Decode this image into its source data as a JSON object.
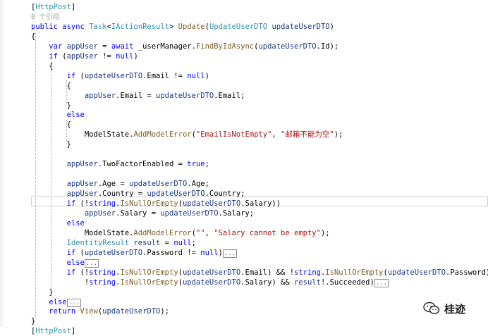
{
  "colors": {
    "keyword": "#0000ff",
    "type": "#2b91af",
    "string": "#a31515",
    "method": "#795e26",
    "variable": "#1f377f",
    "plain": "#000000",
    "codelens": "#9a9a9a",
    "attribute": "#2b91af"
  },
  "watermark": {
    "icon": "wechat-icon",
    "text": "桂迹"
  },
  "code_lines": [
    {
      "tokens": [
        [
          "plain",
          "["
        ],
        [
          "type",
          "HttpPost"
        ],
        [
          "plain",
          "]"
        ]
      ]
    },
    {
      "tokens": [
        [
          "codelens",
          "0 个引用"
        ]
      ]
    },
    {
      "tokens": [
        [
          "keyword",
          "public "
        ],
        [
          "keyword",
          "async "
        ],
        [
          "type",
          "Task"
        ],
        [
          "plain",
          "<"
        ],
        [
          "type",
          "IActionResult"
        ],
        [
          "plain",
          "> "
        ],
        [
          "method",
          "Update"
        ],
        [
          "plain",
          "("
        ],
        [
          "type",
          "UpdateUserDTO"
        ],
        [
          "plain",
          " "
        ],
        [
          "variable",
          "updateUserDTO"
        ],
        [
          "plain",
          ")"
        ]
      ]
    },
    {
      "tokens": [
        [
          "plain",
          "{"
        ]
      ]
    },
    {
      "tokens": [
        [
          "keyword",
          "    var "
        ],
        [
          "variable",
          "appUser"
        ],
        [
          "plain",
          " = "
        ],
        [
          "keyword",
          "await "
        ],
        [
          "plain",
          "_userManager."
        ],
        [
          "method",
          "FindByIdAsync"
        ],
        [
          "plain",
          "("
        ],
        [
          "variable",
          "updateUserDTO"
        ],
        [
          "plain",
          ".Id);"
        ]
      ]
    },
    {
      "tokens": [
        [
          "keyword",
          "    if "
        ],
        [
          "plain",
          "("
        ],
        [
          "variable",
          "appUser"
        ],
        [
          "plain",
          " != "
        ],
        [
          "keyword",
          "null"
        ],
        [
          "plain",
          ")"
        ]
      ]
    },
    {
      "tokens": [
        [
          "plain",
          "    {"
        ]
      ]
    },
    {
      "tokens": [
        [
          "keyword",
          "        if "
        ],
        [
          "plain",
          "("
        ],
        [
          "variable",
          "updateUserDTO"
        ],
        [
          "plain",
          ".Email != "
        ],
        [
          "keyword",
          "null"
        ],
        [
          "plain",
          ")"
        ]
      ]
    },
    {
      "tokens": [
        [
          "plain",
          "        {"
        ]
      ]
    },
    {
      "tokens": [
        [
          "plain",
          "            "
        ],
        [
          "variable",
          "appUser"
        ],
        [
          "plain",
          ".Email = "
        ],
        [
          "variable",
          "updateUserDTO"
        ],
        [
          "plain",
          ".Email;"
        ]
      ]
    },
    {
      "tokens": [
        [
          "plain",
          "        }"
        ]
      ]
    },
    {
      "tokens": [
        [
          "keyword",
          "        else"
        ]
      ]
    },
    {
      "tokens": [
        [
          "plain",
          "        {"
        ]
      ]
    },
    {
      "tokens": [
        [
          "plain",
          "            ModelState."
        ],
        [
          "method",
          "AddModelError"
        ],
        [
          "plain",
          "("
        ],
        [
          "string",
          "\"EmailIsNotEmpty\""
        ],
        [
          "plain",
          ", "
        ],
        [
          "string",
          "\"邮箱不能为空\""
        ],
        [
          "plain",
          ");"
        ]
      ]
    },
    {
      "tokens": [
        [
          "plain",
          "        }"
        ]
      ]
    },
    {
      "tokens": []
    },
    {
      "tokens": [
        [
          "plain",
          "        "
        ],
        [
          "variable",
          "appUser"
        ],
        [
          "plain",
          ".TwoFactorEnabled = "
        ],
        [
          "keyword",
          "true"
        ],
        [
          "plain",
          ";"
        ]
      ]
    },
    {
      "tokens": []
    },
    {
      "tokens": [
        [
          "plain",
          "        "
        ],
        [
          "variable",
          "appUser"
        ],
        [
          "plain",
          ".Age = "
        ],
        [
          "variable",
          "updateUserDTO"
        ],
        [
          "plain",
          ".Age;"
        ]
      ]
    },
    {
      "tokens": [
        [
          "plain",
          "        "
        ],
        [
          "variable",
          "appUser"
        ],
        [
          "plain",
          ".Country = "
        ],
        [
          "variable",
          "updateUserDTO"
        ],
        [
          "plain",
          ".Country;"
        ]
      ]
    },
    {
      "tokens": [
        [
          "keyword",
          "        if "
        ],
        [
          "plain",
          "(!"
        ],
        [
          "keyword",
          "string"
        ],
        [
          "plain",
          "."
        ],
        [
          "method",
          "IsNullOrEmpty"
        ],
        [
          "plain",
          "("
        ],
        [
          "variable",
          "updateUserDTO"
        ],
        [
          "plain",
          ".Salary))"
        ]
      ]
    },
    {
      "tokens": [
        [
          "plain",
          "            "
        ],
        [
          "variable",
          "appUser"
        ],
        [
          "plain",
          ".Salary = "
        ],
        [
          "variable",
          "updateUserDTO"
        ],
        [
          "plain",
          ".Salary;"
        ]
      ]
    },
    {
      "tokens": [
        [
          "keyword",
          "        else"
        ]
      ]
    },
    {
      "tokens": [
        [
          "plain",
          "            ModelState."
        ],
        [
          "method",
          "AddModelError"
        ],
        [
          "plain",
          "("
        ],
        [
          "string",
          "\"\""
        ],
        [
          "plain",
          ", "
        ],
        [
          "string",
          "\"Salary cannot be empty\""
        ],
        [
          "plain",
          ");"
        ]
      ]
    },
    {
      "tokens": [
        [
          "plain",
          "        "
        ],
        [
          "type",
          "IdentityResult"
        ],
        [
          "plain",
          " "
        ],
        [
          "variable",
          "result"
        ],
        [
          "plain",
          " = "
        ],
        [
          "keyword",
          "null"
        ],
        [
          "plain",
          ";"
        ]
      ]
    },
    {
      "tokens": [
        [
          "keyword",
          "        if "
        ],
        [
          "plain",
          "("
        ],
        [
          "variable",
          "updateUserDTO"
        ],
        [
          "plain",
          ".Password != "
        ],
        [
          "keyword",
          "null"
        ],
        [
          "plain",
          ")"
        ],
        [
          "collapsed",
          "..."
        ]
      ]
    },
    {
      "tokens": [
        [
          "keyword",
          "        else"
        ],
        [
          "collapsed",
          "..."
        ]
      ]
    },
    {
      "tokens": [
        [
          "keyword",
          "        if "
        ],
        [
          "plain",
          "(!"
        ],
        [
          "keyword",
          "string"
        ],
        [
          "plain",
          "."
        ],
        [
          "method",
          "IsNullOrEmpty"
        ],
        [
          "plain",
          "("
        ],
        [
          "variable",
          "updateUserDTO"
        ],
        [
          "plain",
          ".Email) && !"
        ],
        [
          "keyword",
          "string"
        ],
        [
          "plain",
          "."
        ],
        [
          "method",
          "IsNullOrEmpty"
        ],
        [
          "plain",
          "("
        ],
        [
          "variable",
          "updateUserDTO"
        ],
        [
          "plain",
          ".Password) &&"
        ]
      ]
    },
    {
      "tokens": [
        [
          "plain",
          "            !"
        ],
        [
          "keyword",
          "string"
        ],
        [
          "plain",
          "."
        ],
        [
          "method",
          "IsNullOrEmpty"
        ],
        [
          "plain",
          "("
        ],
        [
          "variable",
          "updateUserDTO"
        ],
        [
          "plain",
          ".Salary) && "
        ],
        [
          "variable",
          "result"
        ],
        [
          "plain",
          "!.Succeeded)"
        ],
        [
          "collapsed",
          "..."
        ]
      ]
    },
    {
      "tokens": [
        [
          "plain",
          "    }"
        ]
      ]
    },
    {
      "tokens": [
        [
          "keyword",
          "    else"
        ],
        [
          "collapsed",
          "..."
        ]
      ]
    },
    {
      "tokens": [
        [
          "keyword",
          "    return "
        ],
        [
          "method",
          "View"
        ],
        [
          "plain",
          "("
        ],
        [
          "variable",
          "updateUserDTO"
        ],
        [
          "plain",
          ");"
        ]
      ]
    },
    {
      "tokens": [
        [
          "plain",
          "}"
        ]
      ]
    },
    {
      "tokens": [
        [
          "plain",
          "["
        ],
        [
          "type",
          "HttpPost"
        ],
        [
          "plain",
          "]"
        ]
      ]
    }
  ]
}
